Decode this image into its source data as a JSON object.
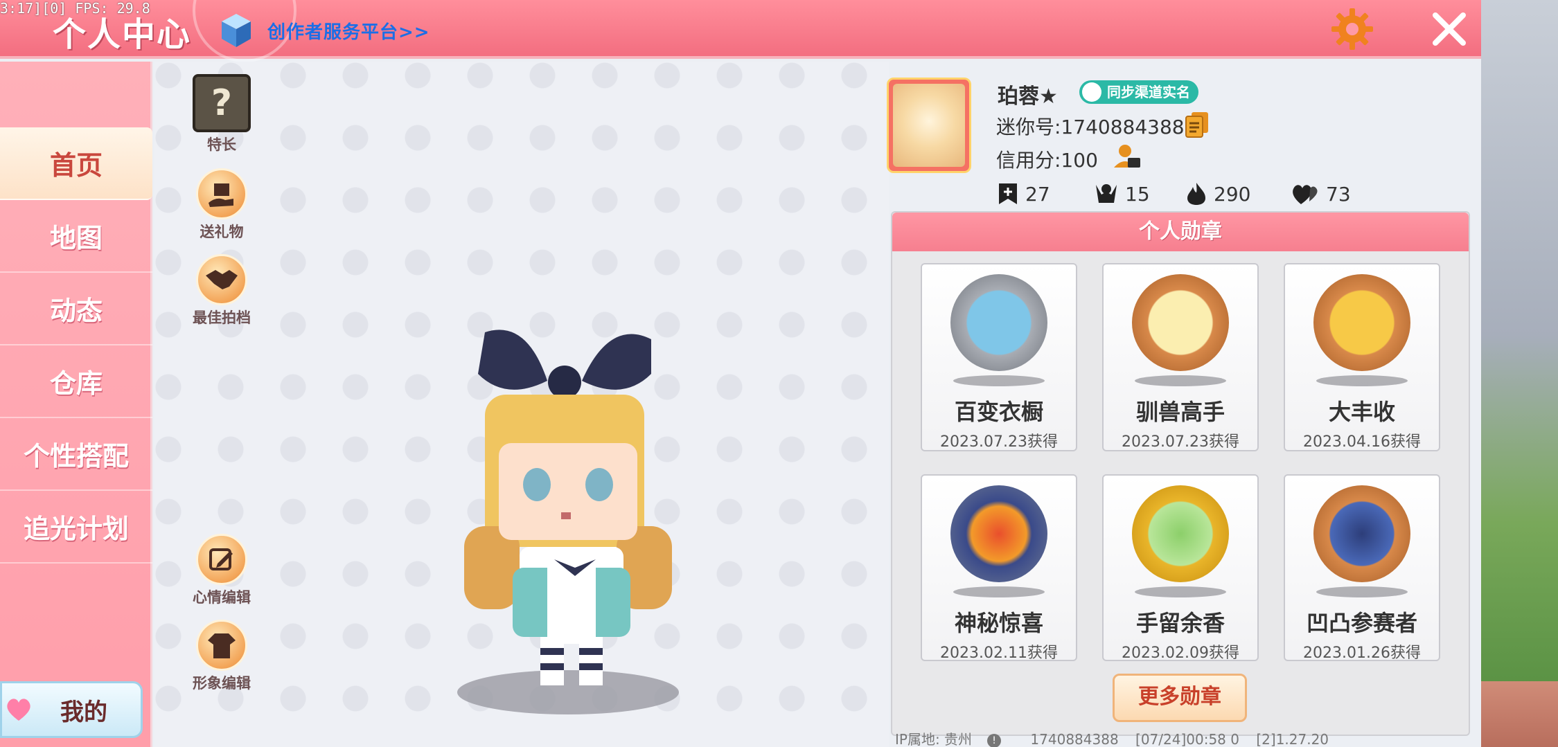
{
  "debug": {
    "fps_text": "3:17][0] FPS: 29.8"
  },
  "header": {
    "title": "个人中心",
    "creator_link": "创作者服务平台>>",
    "settings_icon": "gear-icon",
    "close_icon": "close-icon",
    "accent_color": "#f36e80"
  },
  "sidebar": {
    "items": [
      {
        "label": "首页",
        "active": true
      },
      {
        "label": "地图",
        "active": false
      },
      {
        "label": "动态",
        "active": false
      },
      {
        "label": "仓库",
        "active": false
      },
      {
        "label": "个性搭配",
        "active": false
      },
      {
        "label": "追光计划",
        "active": false
      }
    ],
    "mine_button": "我的"
  },
  "tools": {
    "talent": "特长",
    "send_gift": "送礼物",
    "best_partner": "最佳拍档",
    "mood_edit": "心情编辑",
    "image_edit": "形象编辑"
  },
  "profile": {
    "nickname": "珀蓉★",
    "sync_badge": "同步渠道实名",
    "mini_id": "迷你号:1740884388",
    "credit": "信用分:100",
    "stats": {
      "likes": "27",
      "fans": "15",
      "popularity": "290",
      "favor": "73"
    }
  },
  "medals": {
    "title": "个人勋章",
    "items": [
      {
        "name": "百变衣橱",
        "date": "2023.07.23获得",
        "color": "#a8acb3"
      },
      {
        "name": "驯兽高手",
        "date": "2023.07.23获得",
        "color": "#d8894a"
      },
      {
        "name": "大丰收",
        "date": "2023.04.16获得",
        "color": "#d8894a"
      },
      {
        "name": "神秘惊喜",
        "date": "2023.02.11获得",
        "color": "#6f7a92"
      },
      {
        "name": "手留余香",
        "date": "2023.02.09获得",
        "color": "#e9b52a"
      },
      {
        "name": "凹凸参赛者",
        "date": "2023.01.26获得",
        "color": "#d8894a"
      }
    ],
    "more_button": "更多勋章"
  },
  "footer": {
    "ip": "IP属地: 贵州",
    "id": "1740884388",
    "time": "[07/24]00:58 0",
    "version": "[2]1.27.20"
  }
}
